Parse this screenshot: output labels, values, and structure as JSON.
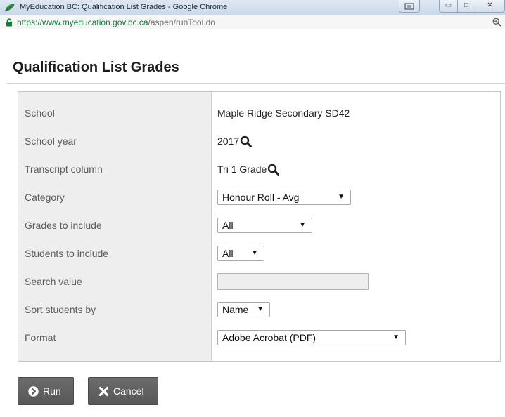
{
  "window": {
    "title": "MyEducation BC: Qualification List Grades - Google Chrome",
    "buttons": {
      "minimize": "▭",
      "maximize": "□",
      "close": "✕"
    }
  },
  "address_bar": {
    "host": "https://www.myeducation.gov.bc.ca",
    "path": "/aspen/runTool.do"
  },
  "page": {
    "title": "Qualification List Grades"
  },
  "form": {
    "rows": [
      {
        "label": "School",
        "value": "Maple Ridge Secondary SD42"
      },
      {
        "label": "School year",
        "value": "2017"
      },
      {
        "label": "Transcript column",
        "value": "Tri 1 Grade"
      },
      {
        "label": "Category",
        "value": "Honour Roll - Avg"
      },
      {
        "label": "Grades to include",
        "value": "All"
      },
      {
        "label": "Students to include",
        "value": "All"
      },
      {
        "label": "Search value",
        "value": ""
      },
      {
        "label": "Sort students by",
        "value": "Name"
      },
      {
        "label": "Format",
        "value": "Adobe Acrobat (PDF)"
      }
    ],
    "caret": "▼"
  },
  "buttons": {
    "run": "Run",
    "cancel": "Cancel"
  },
  "colors": {
    "title_bar": "#d5e1ee",
    "label_column": "#eeeeee",
    "button_bg": "#606060",
    "url_secure": "#0f7b3a"
  },
  "icons": {
    "app": "leaf-logo-icon",
    "lock": "lock-icon",
    "zoom": "zoom-icon",
    "lookup": "magnifier-icon",
    "run": "play-circle-icon",
    "cancel": "x-icon"
  }
}
